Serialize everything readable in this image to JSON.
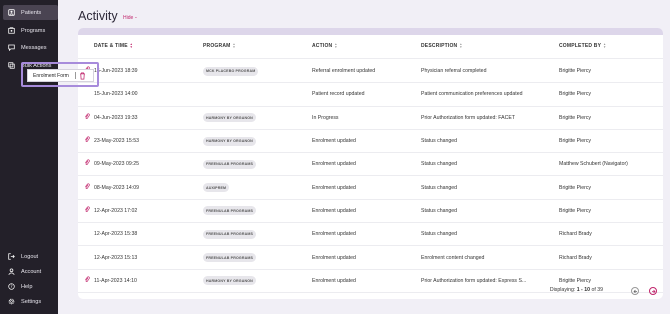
{
  "sidebar": {
    "top_items": [
      {
        "label": "Patients",
        "icon": "patients-icon",
        "active": true
      },
      {
        "label": "Programs",
        "icon": "programs-icon",
        "active": false
      },
      {
        "label": "Messages",
        "icon": "messages-icon",
        "active": false
      },
      {
        "label": "Bulk Actions",
        "icon": "bulk-actions-icon",
        "active": false
      }
    ],
    "bottom_items": [
      {
        "label": "Logout",
        "icon": "logout-icon"
      },
      {
        "label": "Account",
        "icon": "account-icon"
      },
      {
        "label": "Help",
        "icon": "help-icon"
      },
      {
        "label": "Settings",
        "icon": "settings-icon"
      }
    ]
  },
  "popup": {
    "label": "Enrolment Form",
    "icon": "trash-icon"
  },
  "header": {
    "title": "Activity",
    "hide_label": "Hide"
  },
  "table": {
    "columns": [
      "DATE & TIME",
      "PROGRAM",
      "ACTION",
      "DESCRIPTION",
      "COMPLETED BY"
    ],
    "rows": [
      {
        "attachment": true,
        "date": "15-Jun-2023 18:39",
        "program": "MCK PLACEBO PROGRAM",
        "action": "Referral enrolment updated",
        "description": "Physician referral completed",
        "completed_by": "Brigitte Piercy"
      },
      {
        "attachment": false,
        "date": "15-Jun-2023 14:00",
        "program": "",
        "action": "Patient record updated",
        "description": "Patient communication preferences updated",
        "completed_by": "Brigitte Piercy"
      },
      {
        "attachment": true,
        "date": "04-Jun-2023 19:33",
        "program": "HARMONY BY ORGANON",
        "action": "In Progress",
        "description": "Prior Authorization form updated: FACET",
        "completed_by": "Brigitte Piercy"
      },
      {
        "attachment": true,
        "date": "23-May-2023 15:53",
        "program": "HARMONY BY ORGANON",
        "action": "Enrolment updated",
        "description": "Status changed",
        "completed_by": "Brigitte Piercy"
      },
      {
        "attachment": true,
        "date": "09-May-2023 09:25",
        "program": "FREENULAB PROGRAMS",
        "action": "Enrolment updated",
        "description": "Status changed",
        "completed_by": "Matthew Schubert (Navigator)"
      },
      {
        "attachment": true,
        "date": "08-May-2023 14:09",
        "program": "AUXIPREM",
        "action": "Enrolment updated",
        "description": "Status changed",
        "completed_by": "Brigitte Piercy"
      },
      {
        "attachment": true,
        "date": "12-Apr-2023 17:02",
        "program": "FREENULAB PROGRAMS",
        "action": "Enrolment updated",
        "description": "Status changed",
        "completed_by": "Brigitte Piercy"
      },
      {
        "attachment": false,
        "date": "12-Apr-2023 15:38",
        "program": "FREENULAB PROGRAMS",
        "action": "Enrolment updated",
        "description": "Status changed",
        "completed_by": "Richard Brady"
      },
      {
        "attachment": false,
        "date": "12-Apr-2023 15:13",
        "program": "FREENULAB PROGRAMS",
        "action": "Enrolment updated",
        "description": "Enrolment content changed",
        "completed_by": "Richard Brady"
      },
      {
        "attachment": true,
        "date": "11-Apr-2023 14:10",
        "program": "HARMONY BY ORGANON",
        "action": "Enrolment updated",
        "description": "Prior Authorization form updated: Express S...",
        "completed_by": "Brigitte Piercy"
      }
    ]
  },
  "footer": {
    "displaying_label": "Displaying:",
    "range": "1 - 10",
    "of_label": "of 39"
  },
  "colors": {
    "sidebar_bg": "#232029",
    "accent": "#c0246b",
    "highlight": "#a78bdb",
    "page_bg": "#f1eff6"
  }
}
